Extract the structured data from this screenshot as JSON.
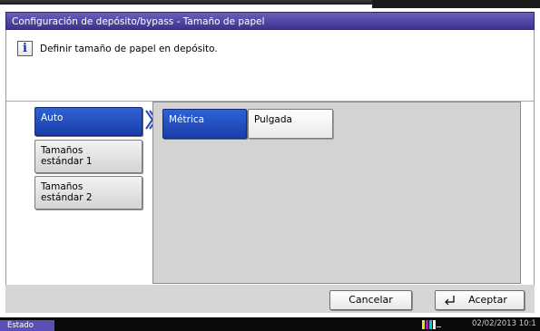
{
  "window": {
    "title": "Configuración de depósito/bypass - Tamaño de papel"
  },
  "message": {
    "icon": "info-icon",
    "text": "Definir tamaño de papel en depósito."
  },
  "sidebar": {
    "items": [
      {
        "label": "Auto",
        "selected": true
      },
      {
        "label_line1": "Tamaños",
        "label_line2": "estándar 1",
        "selected": false
      },
      {
        "label_line1": "Tamaños",
        "label_line2": "estándar 2",
        "selected": false
      }
    ]
  },
  "units": {
    "options": [
      {
        "label": "Métrica",
        "selected": true
      },
      {
        "label": "Pulgada",
        "selected": false
      }
    ]
  },
  "actions": {
    "cancel_label": "Cancelar",
    "accept_label": "Aceptar"
  },
  "status": {
    "label": "Estado",
    "datetime": "02/02/2013 10:1"
  },
  "colors": {
    "accent": "#2a55c6",
    "title_bar": "#4d44a4"
  }
}
